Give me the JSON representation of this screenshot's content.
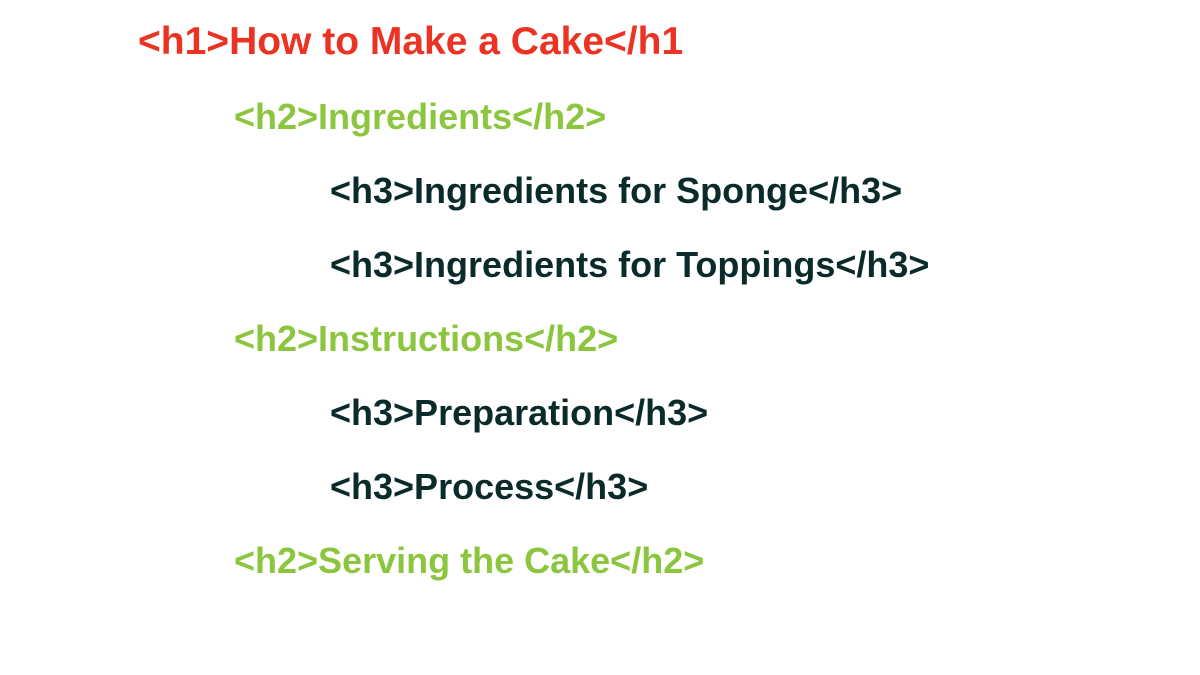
{
  "lines": {
    "l1": "<h1>How to Make a Cake</h1",
    "l2": "<h2>Ingredients</h2>",
    "l3": "<h3>Ingredients for Sponge</h3>",
    "l4": "<h3>Ingredients for Toppings</h3>",
    "l5": "<h2>Instructions</h2>",
    "l6": "<h3>Preparation</h3>",
    "l7": "<h3>Process</h3>",
    "l8": "<h2>Serving the Cake</h2>"
  },
  "colors": {
    "h1": "#eb3223",
    "h2": "#8cc63f",
    "h3": "#0b2b2b"
  }
}
